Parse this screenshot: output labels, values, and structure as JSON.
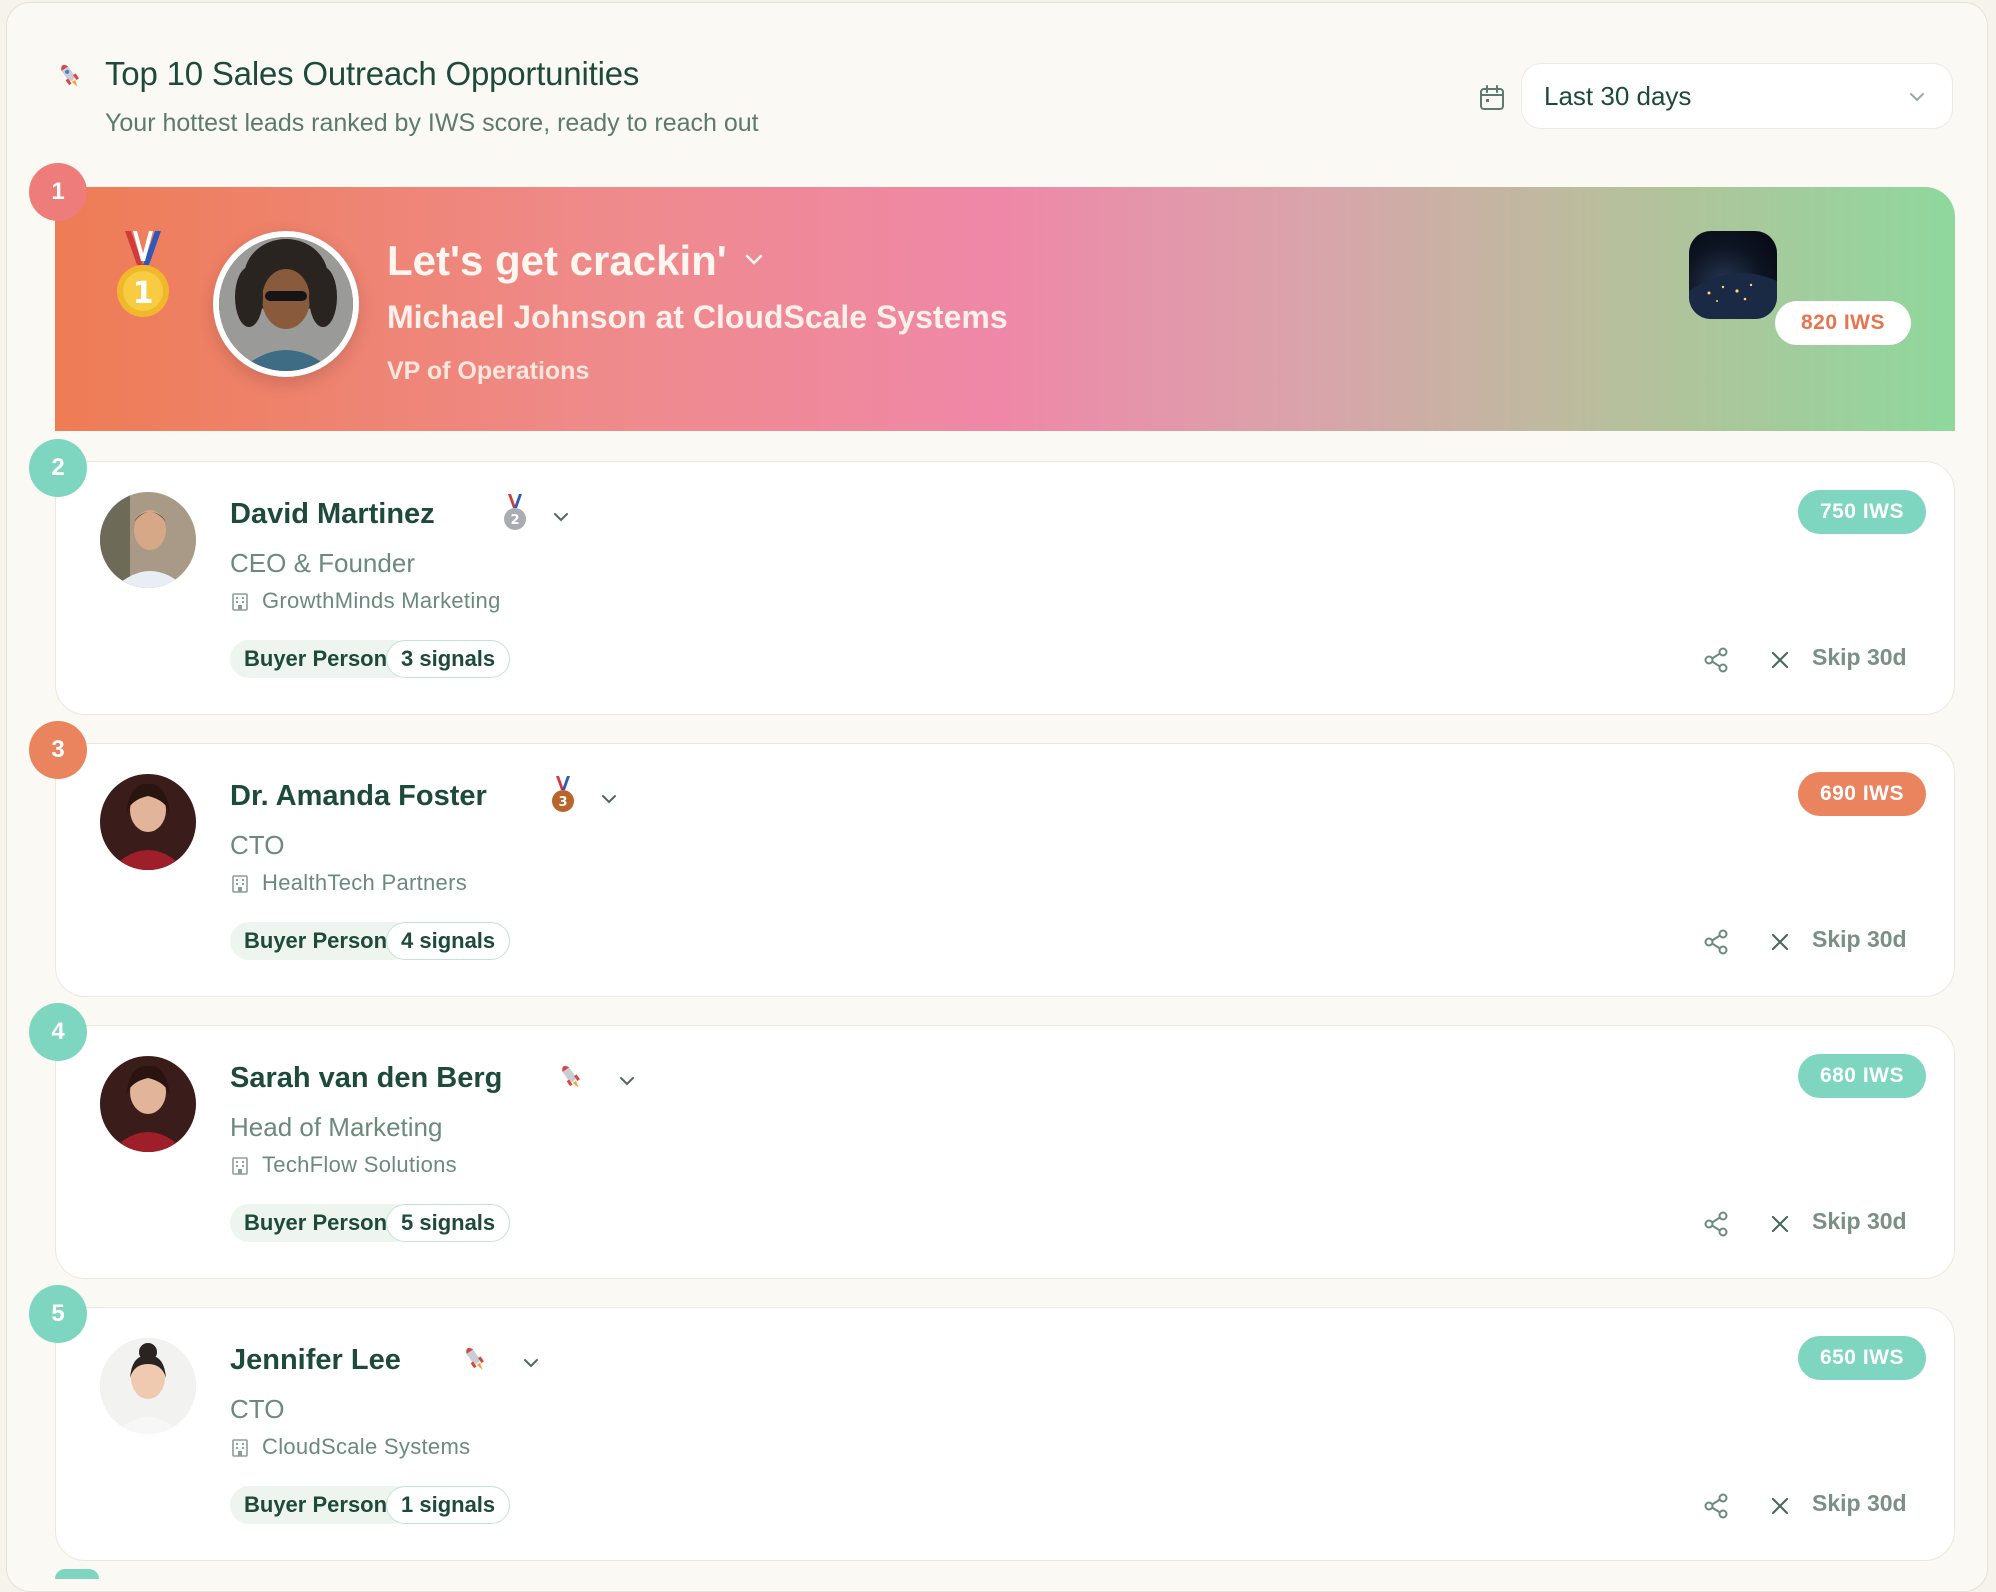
{
  "header": {
    "icon": "rocket-icon",
    "title": "Top 10 Sales Outreach Opportunities",
    "subtitle": "Your hottest leads ranked by IWS score, ready to reach out",
    "date_filter": {
      "icon": "calendar-icon",
      "selected": "Last 30 days"
    }
  },
  "hero": {
    "rank": "1",
    "medal_icon": "gold-medal-icon",
    "title": "Let's get crackin'",
    "company_line": "Michael Johnson at CloudScale Systems",
    "role": "VP of Operations",
    "iws": "820 IWS",
    "colors": {
      "rank": "#ee7c7a",
      "iws_text": "#e8744e"
    }
  },
  "leads": [
    {
      "rank": "2",
      "name": "David Martinez",
      "name_icon": "silver-medal-icon",
      "role": "CEO & Founder",
      "company": "GrowthMinds Marketing",
      "persona": "Buyer Persona",
      "signals": "3 signals",
      "iws": "750 IWS",
      "skip": "Skip 30d",
      "rank_color": "#7ed6c0",
      "iws_color": "#7ed6c0"
    },
    {
      "rank": "3",
      "name": "Dr. Amanda Foster",
      "name_icon": "bronze-medal-icon",
      "role": "CTO",
      "company": "HealthTech Partners",
      "persona": "Buyer Persona",
      "signals": "4 signals",
      "iws": "690 IWS",
      "skip": "Skip 30d",
      "rank_color": "#e9845e",
      "iws_color": "#e9845e"
    },
    {
      "rank": "4",
      "name": "Sarah van den Berg",
      "name_icon": "rocket-icon",
      "role": "Head of Marketing",
      "company": "TechFlow Solutions",
      "persona": "Buyer Persona",
      "signals": "5 signals",
      "iws": "680 IWS",
      "skip": "Skip 30d",
      "rank_color": "#7ed6c0",
      "iws_color": "#7ed6c0"
    },
    {
      "rank": "5",
      "name": "Jennifer Lee",
      "name_icon": "rocket-icon",
      "role": "CTO",
      "company": "CloudScale Systems",
      "persona": "Buyer Persona",
      "signals": "1 signals",
      "iws": "650 IWS",
      "skip": "Skip 30d",
      "rank_color": "#7ed6c0",
      "iws_color": "#7ed6c0"
    }
  ]
}
